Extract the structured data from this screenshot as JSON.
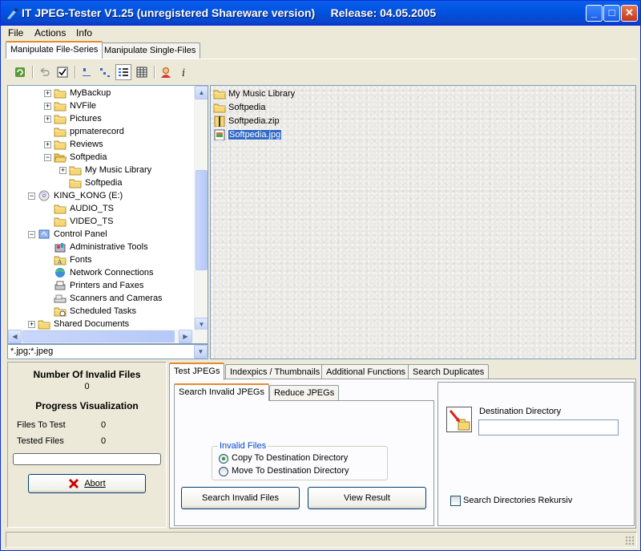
{
  "window": {
    "title": "IT JPEG-Tester V1.25 (unregistered Shareware version)     Release: 04.05.2005",
    "minimize": "_",
    "maximize": "□",
    "close": "✕"
  },
  "menu": {
    "file": "File",
    "actions": "Actions",
    "info": "Info"
  },
  "top_tabs": [
    "Manipulate File-Series",
    "Manipulate Single-Files"
  ],
  "toolbar_icons": [
    "refresh-icon",
    "undo-icon",
    "check-icon",
    "small-icons-icon",
    "list-icon",
    "details-icon",
    "grid-icon",
    "user-icon",
    "info-icon"
  ],
  "tree": [
    {
      "label": "MyBackup",
      "indent": 2,
      "expander": "+",
      "icon": "folder"
    },
    {
      "label": "NVFile",
      "indent": 2,
      "expander": "+",
      "icon": "folder"
    },
    {
      "label": "Pictures",
      "indent": 2,
      "expander": "+",
      "icon": "folder"
    },
    {
      "label": "ppmaterecord",
      "indent": 2,
      "expander": "",
      "icon": "folder"
    },
    {
      "label": "Reviews",
      "indent": 2,
      "expander": "+",
      "icon": "folder"
    },
    {
      "label": "Softpedia",
      "indent": 2,
      "expander": "-",
      "icon": "folder-open"
    },
    {
      "label": "My Music Library",
      "indent": 3,
      "expander": "+",
      "icon": "folder"
    },
    {
      "label": "Softpedia",
      "indent": 3,
      "expander": "",
      "icon": "folder"
    },
    {
      "label": "KING_KONG (E:)",
      "indent": 1,
      "expander": "-",
      "icon": "cd"
    },
    {
      "label": "AUDIO_TS",
      "indent": 2,
      "expander": "",
      "icon": "folder"
    },
    {
      "label": "VIDEO_TS",
      "indent": 2,
      "expander": "",
      "icon": "folder"
    },
    {
      "label": "Control Panel",
      "indent": 1,
      "expander": "-",
      "icon": "control-panel"
    },
    {
      "label": "Administrative Tools",
      "indent": 2,
      "expander": "",
      "icon": "admin-tools"
    },
    {
      "label": "Fonts",
      "indent": 2,
      "expander": "",
      "icon": "fonts"
    },
    {
      "label": "Network Connections",
      "indent": 2,
      "expander": "",
      "icon": "network"
    },
    {
      "label": "Printers and Faxes",
      "indent": 2,
      "expander": "",
      "icon": "printer"
    },
    {
      "label": "Scanners and Cameras",
      "indent": 2,
      "expander": "",
      "icon": "scanner"
    },
    {
      "label": "Scheduled Tasks",
      "indent": 2,
      "expander": "",
      "icon": "tasks"
    },
    {
      "label": "Shared Documents",
      "indent": 1,
      "expander": "+",
      "icon": "folder"
    }
  ],
  "filter": "*.jpg;*.jpeg",
  "files": [
    {
      "label": "My Music Library",
      "icon": "folder",
      "selected": false
    },
    {
      "label": "Softpedia",
      "icon": "folder",
      "selected": false
    },
    {
      "label": "Softpedia.zip",
      "icon": "zip",
      "selected": false
    },
    {
      "label": "Softpedia.jpg",
      "icon": "jpg",
      "selected": true
    }
  ],
  "stats": {
    "invalid_title": "Number Of Invalid Files",
    "invalid_value": "0",
    "progress_title": "Progress Visualization",
    "files_to_test_label": "Files To Test",
    "files_to_test_value": "0",
    "tested_files_label": "Tested Files",
    "tested_files_value": "0",
    "progress": 0,
    "abort_label": "Abort"
  },
  "main_tabs": [
    "Test JPEGs",
    "Indexpics / Thumbnails",
    "Additional Functions",
    "Search Duplicates"
  ],
  "sub_tabs": [
    "Search Invalid JPEGs",
    "Reduce JPEGs"
  ],
  "invalid_files": {
    "legend": "Invalid Files",
    "option_copy": "Copy To Destination Directory",
    "option_move": "Move To Destination Directory",
    "selected": "copy"
  },
  "buttons": {
    "search": "Search Invalid Files",
    "view": "View Result"
  },
  "destination": {
    "label": "Destination Directory",
    "value": "",
    "recursive_label": "Search Directories Rekursiv",
    "recursive_checked": false
  }
}
